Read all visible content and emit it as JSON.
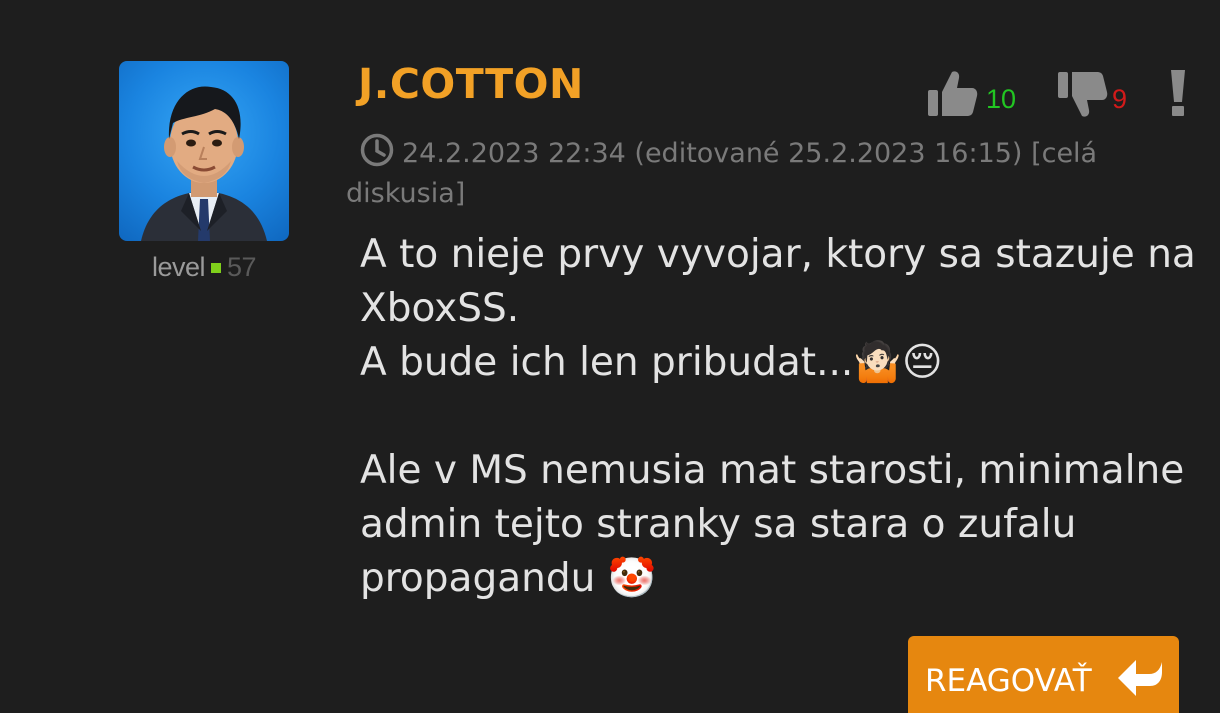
{
  "comment": {
    "username": "J.COTTON",
    "level_label": "level",
    "level_value": "57",
    "votes": {
      "up_count": "10",
      "down_count": "9"
    },
    "meta": {
      "timestamp": "24.2.2023 22:34",
      "edited": "(editované 25.2.2023 16:15)",
      "discussion_link": "[celá diskusia]"
    },
    "body": {
      "line1": "A to nieje prvy vyvojar, ktory sa stazuje na XboxSS.",
      "line2": "A bude ich len pribudat...🤷🏻😔",
      "line3": "Ale v MS nemusia mat starosti, minimalne admin tejto stranky sa stara o zufalu propagandu 🤡"
    },
    "reply_button": "REAGOVAŤ"
  },
  "colors": {
    "background": "#1e1e1e",
    "username": "#f2a126",
    "upvote": "#22c522",
    "downvote": "#d11a1a",
    "level_indicator": "#7fd01b",
    "button": "#e6870f"
  },
  "icons": [
    "thumbs-up-icon",
    "thumbs-down-icon",
    "exclamation-icon",
    "clock-icon",
    "reply-arrow-icon"
  ]
}
